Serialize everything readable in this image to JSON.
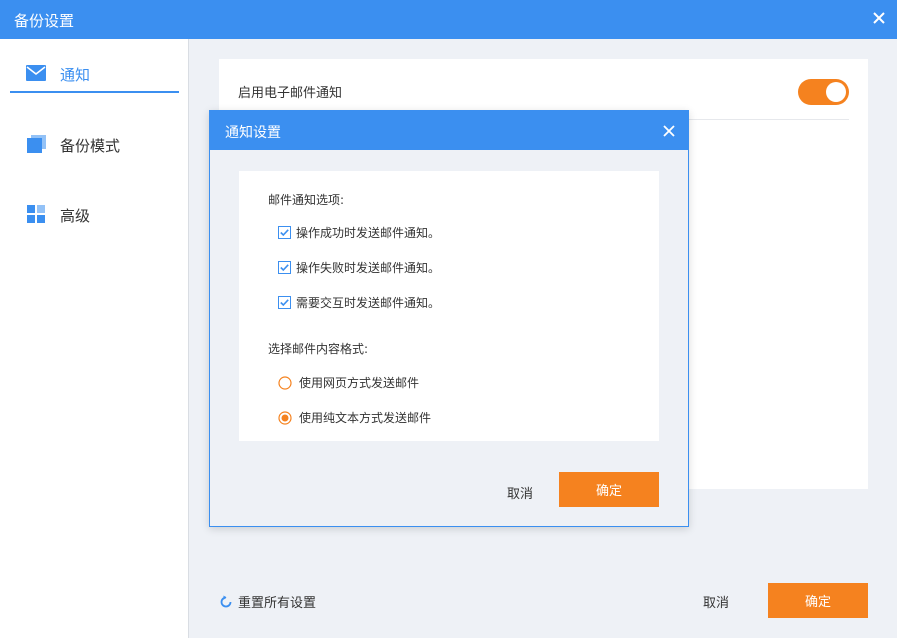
{
  "window": {
    "title": "备份设置",
    "close_icon": "close-icon"
  },
  "colors": {
    "accent": "#3b8ff0",
    "primary_button": "#f5821f",
    "toggle_on": "#f5821f"
  },
  "sidebar": {
    "items": [
      {
        "label": "通知",
        "icon": "mail-icon",
        "active": true
      },
      {
        "label": "备份模式",
        "icon": "backup-mode-icon",
        "active": false
      },
      {
        "label": "高级",
        "icon": "grid-icon",
        "active": false
      }
    ]
  },
  "main": {
    "email_notify_label": "启用电子邮件通知",
    "email_notify_enabled": true,
    "reset_label": "重置所有设置",
    "cancel_label": "取消",
    "ok_label": "确定"
  },
  "dialog": {
    "title": "通知设置",
    "email_options_label": "邮件通知选项:",
    "checkboxes": [
      {
        "label": "操作成功时发送邮件通知。",
        "checked": true
      },
      {
        "label": "操作失败时发送邮件通知。",
        "checked": true
      },
      {
        "label": "需要交互时发送邮件通知。",
        "checked": true
      }
    ],
    "format_label": "选择邮件内容格式:",
    "radios": [
      {
        "label": "使用网页方式发送邮件",
        "selected": false
      },
      {
        "label": "使用纯文本方式发送邮件",
        "selected": true
      }
    ],
    "cancel_label": "取消",
    "ok_label": "确定"
  }
}
